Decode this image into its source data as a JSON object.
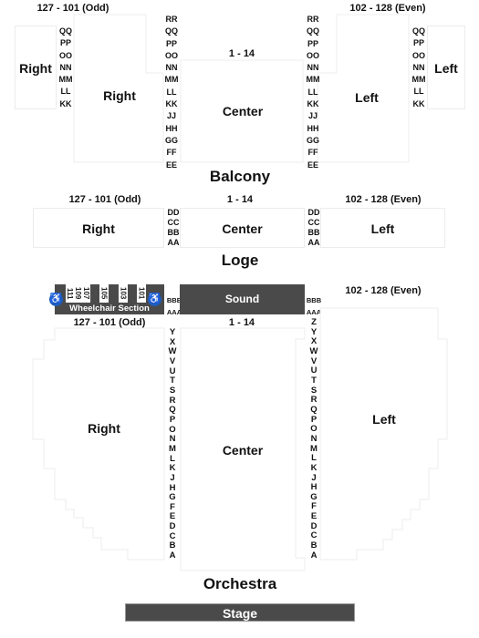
{
  "balcony": {
    "level_label": "Balcony",
    "ranges": {
      "right": "127 - 101 (Odd)",
      "center": "1 - 14",
      "left": "102 - 128 (Even)"
    },
    "sections": {
      "far_right": "Right",
      "right": "Right",
      "center": "Center",
      "left": "Left",
      "far_left": "Left"
    },
    "outer_rows": [
      "QQ",
      "PP",
      "OO",
      "NN",
      "MM",
      "LL",
      "KK"
    ],
    "inner_rows": [
      "RR",
      "QQ",
      "PP",
      "OO",
      "NN",
      "MM",
      "LL",
      "KK",
      "JJ",
      "HH",
      "GG",
      "FF",
      "EE"
    ]
  },
  "loge": {
    "level_label": "Loge",
    "ranges": {
      "right": "127 - 101 (Odd)",
      "center": "1 - 14",
      "left": "102 - 128 (Even)"
    },
    "sections": {
      "right": "Right",
      "center": "Center",
      "left": "Left"
    },
    "rows": [
      "DD",
      "CC",
      "BB",
      "AA"
    ]
  },
  "orchestra": {
    "level_label": "Orchestra",
    "ranges": {
      "right": "127 - 101 (Odd)",
      "center": "1 - 14",
      "left": "102 - 128 (Even)"
    },
    "sections": {
      "right": "Right",
      "center": "Center",
      "left": "Left"
    },
    "sound_label": "Sound",
    "wheelchair": {
      "label": "Wheelchair Section",
      "seats": [
        "111",
        "109",
        "107",
        "105",
        "103",
        "101"
      ],
      "icon": "wheelchair-accessible-icon"
    },
    "upper_rows": [
      "BBB",
      "AAA"
    ],
    "left_aisle_rows": [
      "Y",
      "X",
      "W",
      "V",
      "U",
      "T",
      "S",
      "R",
      "Q",
      "P",
      "O",
      "N",
      "M",
      "L",
      "K",
      "J",
      "H",
      "G",
      "F",
      "E",
      "D",
      "C",
      "B",
      "A"
    ],
    "right_aisle_rows": [
      "Z",
      "Y",
      "X",
      "W",
      "V",
      "U",
      "T",
      "S",
      "R",
      "Q",
      "P",
      "O",
      "N",
      "M",
      "L",
      "K",
      "J",
      "H",
      "G",
      "F",
      "E",
      "D",
      "C",
      "B",
      "A"
    ]
  },
  "stage": {
    "label": "Stage"
  },
  "colors": {
    "dark_block": "#4a4a4a",
    "accessible_blue": "#1f5fbf",
    "section_border": "#ececec"
  }
}
